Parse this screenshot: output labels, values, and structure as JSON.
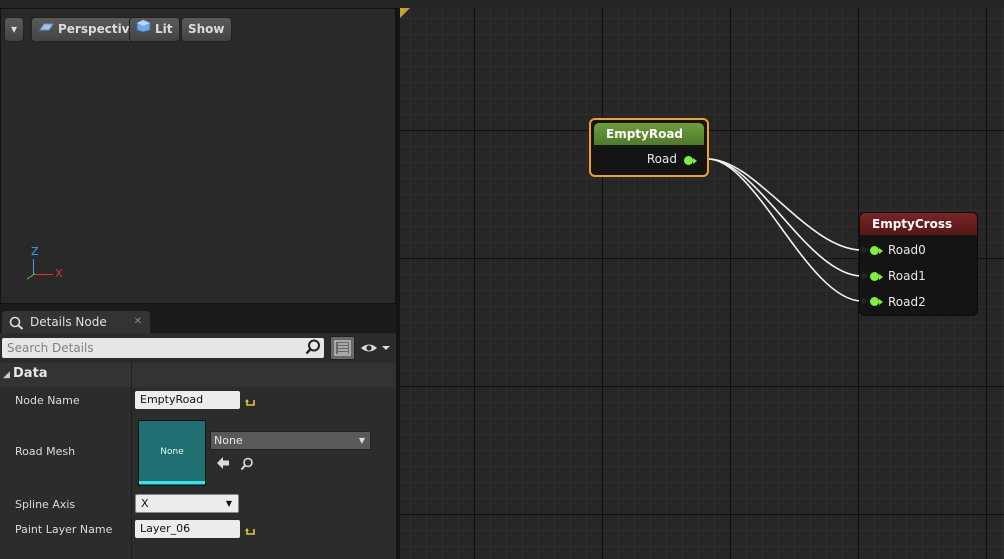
{
  "viewport": {
    "dropdown_glyph": "▾",
    "perspective_label": "Perspective",
    "lit_label": "Lit",
    "show_label": "Show",
    "axis_labels": {
      "x": "X",
      "z": "Z"
    }
  },
  "details": {
    "tab_title": "Details Node",
    "tab_close": "✕",
    "search_placeholder": "Search Details",
    "category": "Data",
    "properties": {
      "node_name_label": "Node Name",
      "node_name_value": "EmptyRoad",
      "road_mesh_label": "Road Mesh",
      "road_mesh_thumb": "None",
      "road_mesh_combo": "None",
      "spline_axis_label": "Spline Axis",
      "spline_axis_value": "X",
      "paint_layer_label": "Paint Layer Name",
      "paint_layer_value": "Layer_06"
    }
  },
  "graph": {
    "nodes": [
      {
        "title": "EmptyRoad",
        "title_color": "#5e8b35",
        "selected": true,
        "outputs": [
          "Road"
        ]
      },
      {
        "title": "EmptyCross",
        "title_color": "#6e1f1f",
        "selected": false,
        "inputs": [
          "Road0",
          "Road1",
          "Road2"
        ]
      }
    ],
    "pin_color": "#7ff03d",
    "selection_color": "#f0a12a"
  }
}
